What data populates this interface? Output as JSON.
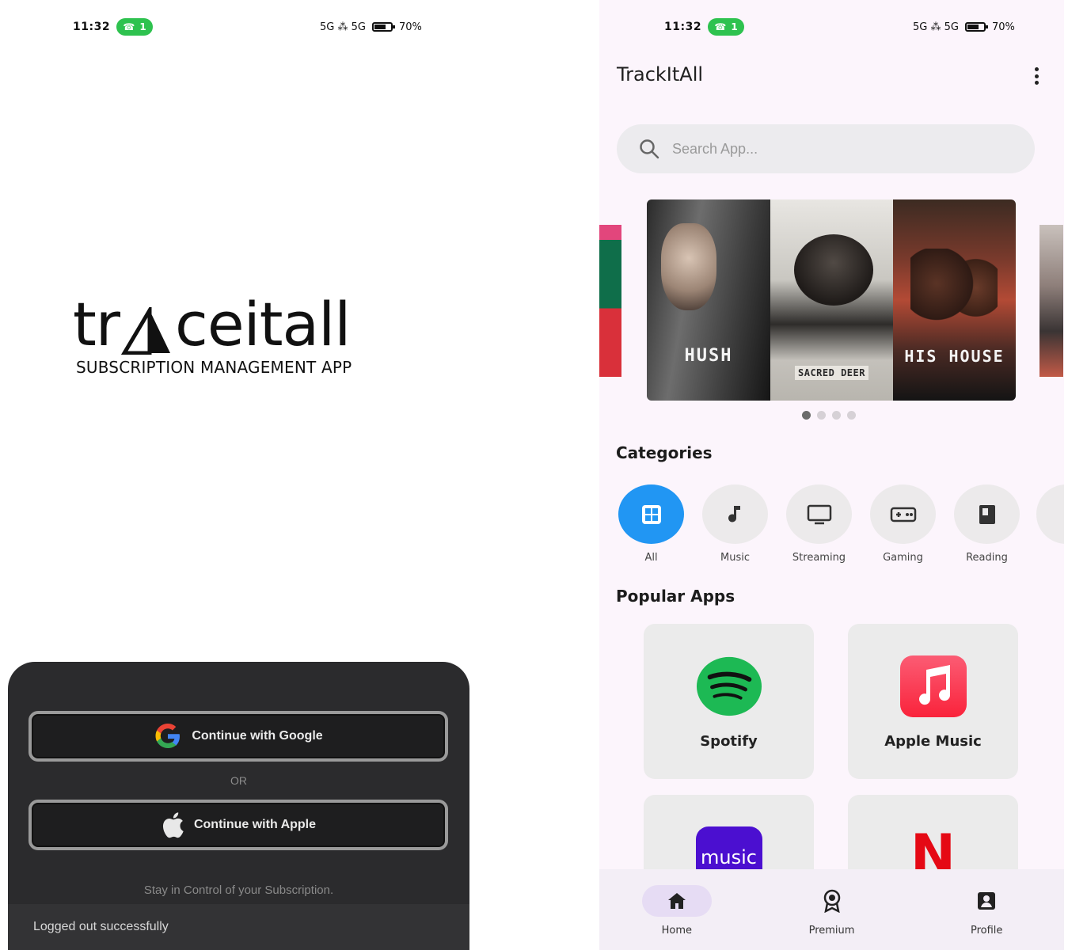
{
  "login_screen": {
    "status_bar": {
      "time": "11:32",
      "pill_text": "1",
      "network_text": "5G ⁂ 5G",
      "battery_text": "70%"
    },
    "logo": {
      "wordmark_left": "tr",
      "wordmark_right": "ceitall",
      "subtitle": "SUBSCRIPTION MANAGEMENT APP"
    },
    "google_button_label": "Continue with Google",
    "or_text": "OR",
    "apple_button_label": "Continue with Apple",
    "tagline": "Stay in Control of your Subscription.",
    "toast": "Logged out successfully"
  },
  "home_screen": {
    "status_bar": {
      "time": "11:32",
      "pill_text": "1",
      "network_text": "5G ⁂ 5G",
      "battery_text": "70%"
    },
    "app_title": "TrackItAll",
    "search": {
      "placeholder": "Search App..."
    },
    "banner": {
      "posters": [
        {
          "title": "HUSH"
        },
        {
          "title": "SACRED DEER"
        },
        {
          "title": "HIS HOUSE"
        }
      ],
      "page_count": 4,
      "active_index": 0
    },
    "categories_title": "Categories",
    "categories": [
      {
        "label": "All",
        "icon": "grid-icon",
        "active": true
      },
      {
        "label": "Music",
        "icon": "music-note-icon",
        "active": false
      },
      {
        "label": "Streaming",
        "icon": "tv-icon",
        "active": false
      },
      {
        "label": "Gaming",
        "icon": "gamepad-icon",
        "active": false
      },
      {
        "label": "Reading",
        "icon": "book-icon",
        "active": false
      }
    ],
    "popular_title": "Popular Apps",
    "popular_apps": [
      {
        "name": "Spotify",
        "icon": "spotify-icon",
        "color": "#1db954"
      },
      {
        "name": "Apple Music",
        "icon": "apple-music-icon",
        "color": "#fa2d48"
      },
      {
        "name": "",
        "icon_text": "music",
        "icon": "amazon-music-icon",
        "color": "#4b0fd0"
      },
      {
        "name": "",
        "icon_text": "N",
        "icon": "netflix-icon",
        "color": "#e50914"
      }
    ],
    "nav": [
      {
        "label": "Home",
        "icon": "home-icon",
        "active": true
      },
      {
        "label": "Premium",
        "icon": "premium-badge-icon",
        "active": false
      },
      {
        "label": "Profile",
        "icon": "profile-icon",
        "active": false
      }
    ],
    "colors": {
      "accent": "#2196f3",
      "background": "#fcf5fc",
      "nav_active": "#e6dcf4"
    }
  }
}
